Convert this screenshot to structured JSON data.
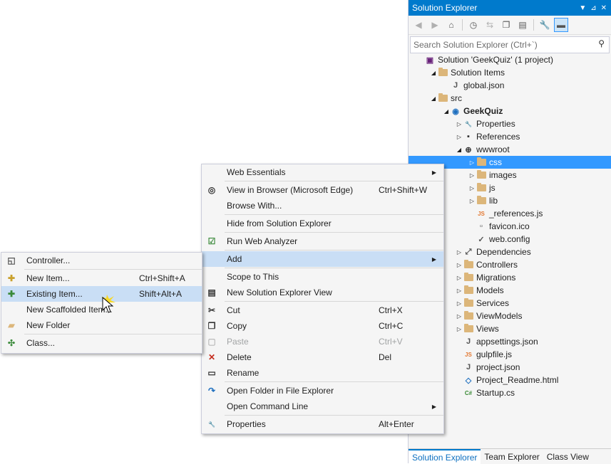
{
  "solution_explorer": {
    "title": "Solution Explorer",
    "title_buttons": [
      "▼",
      "⊿",
      "✕"
    ],
    "search_placeholder": "Search Solution Explorer (Ctrl+`)",
    "tree": [
      {
        "label": "Solution 'GeekQuiz' (1 project)",
        "level": 0,
        "expander": "",
        "icon": "solution-icon",
        "bold": false
      },
      {
        "label": "Solution Items",
        "level": 1,
        "expander": "◢",
        "icon": "folder-icon",
        "bold": false
      },
      {
        "label": "global.json",
        "level": 2,
        "expander": "",
        "icon": "json-file-icon",
        "bold": false
      },
      {
        "label": "src",
        "level": 1,
        "expander": "◢",
        "icon": "folder-icon",
        "bold": false
      },
      {
        "label": "GeekQuiz",
        "level": 2,
        "expander": "◢",
        "icon": "web-project-icon",
        "bold": true
      },
      {
        "label": "Properties",
        "level": 3,
        "expander": "▷",
        "icon": "wrench-icon",
        "bold": false
      },
      {
        "label": "References",
        "level": 3,
        "expander": "▷",
        "icon": "references-icon",
        "bold": false
      },
      {
        "label": "wwwroot",
        "level": 3,
        "expander": "◢",
        "icon": "globe-icon",
        "bold": false
      },
      {
        "label": "css",
        "level": 4,
        "expander": "▷",
        "icon": "folder-icon",
        "bold": false,
        "selected": true
      },
      {
        "label": "images",
        "level": 4,
        "expander": "▷",
        "icon": "folder-icon",
        "bold": false
      },
      {
        "label": "js",
        "level": 4,
        "expander": "▷",
        "icon": "folder-icon",
        "bold": false
      },
      {
        "label": "lib",
        "level": 4,
        "expander": "▷",
        "icon": "folder-icon",
        "bold": false
      },
      {
        "label": "_references.js",
        "level": 4,
        "expander": "",
        "icon": "js-file-icon",
        "bold": false
      },
      {
        "label": "favicon.ico",
        "level": 4,
        "expander": "",
        "icon": "ico-file-icon",
        "bold": false
      },
      {
        "label": "web.config",
        "level": 4,
        "expander": "",
        "icon": "config-file-icon",
        "bold": false
      },
      {
        "label": "Dependencies",
        "level": 3,
        "expander": "▷",
        "icon": "dependencies-icon",
        "bold": false
      },
      {
        "label": "Controllers",
        "level": 3,
        "expander": "▷",
        "icon": "folder-icon",
        "bold": false
      },
      {
        "label": "Migrations",
        "level": 3,
        "expander": "▷",
        "icon": "folder-icon",
        "bold": false
      },
      {
        "label": "Models",
        "level": 3,
        "expander": "▷",
        "icon": "folder-icon",
        "bold": false
      },
      {
        "label": "Services",
        "level": 3,
        "expander": "▷",
        "icon": "folder-icon",
        "bold": false
      },
      {
        "label": "ViewModels",
        "level": 3,
        "expander": "▷",
        "icon": "folder-icon",
        "bold": false
      },
      {
        "label": "Views",
        "level": 3,
        "expander": "▷",
        "icon": "folder-icon",
        "bold": false
      },
      {
        "label": "appsettings.json",
        "level": 3,
        "expander": "",
        "icon": "json-file-icon",
        "bold": false
      },
      {
        "label": "gulpfile.js",
        "level": 3,
        "expander": "",
        "icon": "js-file-icon",
        "bold": false
      },
      {
        "label": "project.json",
        "level": 3,
        "expander": "",
        "icon": "json-file-icon",
        "bold": false
      },
      {
        "label": "Project_Readme.html",
        "level": 3,
        "expander": "",
        "icon": "html-file-icon",
        "bold": false
      },
      {
        "label": "Startup.cs",
        "level": 3,
        "expander": "",
        "icon": "csharp-file-icon",
        "bold": false
      }
    ],
    "bottom_tabs": [
      "Solution Explorer",
      "Team Explorer",
      "Class View"
    ]
  },
  "context_menu": {
    "items": [
      {
        "type": "item",
        "label": "Web Essentials",
        "shortcut": "",
        "submenu": true,
        "icon": ""
      },
      {
        "type": "sep"
      },
      {
        "type": "item",
        "label": "View in Browser (Microsoft Edge)",
        "shortcut": "Ctrl+Shift+W",
        "icon": "browser-icon"
      },
      {
        "type": "item",
        "label": "Browse With...",
        "shortcut": "",
        "icon": ""
      },
      {
        "type": "sep"
      },
      {
        "type": "item",
        "label": "Hide from Solution Explorer",
        "shortcut": "",
        "icon": ""
      },
      {
        "type": "sep"
      },
      {
        "type": "item",
        "label": "Run Web Analyzer",
        "shortcut": "",
        "icon": "analyzer-icon"
      },
      {
        "type": "sep"
      },
      {
        "type": "item",
        "label": "Add",
        "shortcut": "",
        "submenu": true,
        "highlighted": true,
        "icon": ""
      },
      {
        "type": "sep"
      },
      {
        "type": "item",
        "label": "Scope to This",
        "shortcut": "",
        "icon": ""
      },
      {
        "type": "item",
        "label": "New Solution Explorer View",
        "shortcut": "",
        "icon": "new-view-icon"
      },
      {
        "type": "sep"
      },
      {
        "type": "item",
        "label": "Cut",
        "shortcut": "Ctrl+X",
        "icon": "cut-icon"
      },
      {
        "type": "item",
        "label": "Copy",
        "shortcut": "Ctrl+C",
        "icon": "copy-icon"
      },
      {
        "type": "item",
        "label": "Paste",
        "shortcut": "Ctrl+V",
        "disabled": true,
        "icon": "paste-icon"
      },
      {
        "type": "item",
        "label": "Delete",
        "shortcut": "Del",
        "icon": "delete-icon"
      },
      {
        "type": "item",
        "label": "Rename",
        "shortcut": "",
        "icon": "rename-icon"
      },
      {
        "type": "sep"
      },
      {
        "type": "item",
        "label": "Open Folder in File Explorer",
        "shortcut": "",
        "icon": "open-folder-icon"
      },
      {
        "type": "item",
        "label": "Open Command Line",
        "shortcut": "",
        "submenu": true,
        "icon": ""
      },
      {
        "type": "sep"
      },
      {
        "type": "item",
        "label": "Properties",
        "shortcut": "Alt+Enter",
        "icon": "wrench-icon"
      }
    ]
  },
  "add_submenu": {
    "items": [
      {
        "type": "item",
        "label": "Controller...",
        "shortcut": "",
        "icon": "controller-icon"
      },
      {
        "type": "sep"
      },
      {
        "type": "item",
        "label": "New Item...",
        "shortcut": "Ctrl+Shift+A",
        "icon": "new-item-icon"
      },
      {
        "type": "item",
        "label": "Existing Item...",
        "shortcut": "Shift+Alt+A",
        "highlighted": true,
        "icon": "existing-item-icon"
      },
      {
        "type": "item",
        "label": "New Scaffolded Item...",
        "shortcut": "",
        "icon": ""
      },
      {
        "type": "item",
        "label": "New Folder",
        "shortcut": "",
        "icon": "new-folder-icon"
      },
      {
        "type": "sep"
      },
      {
        "type": "item",
        "label": "Class...",
        "shortcut": "",
        "icon": "class-icon"
      }
    ]
  },
  "colors": {
    "accent": "#007acc",
    "selection": "#3399ff",
    "menu_highlight": "#c9def5"
  }
}
